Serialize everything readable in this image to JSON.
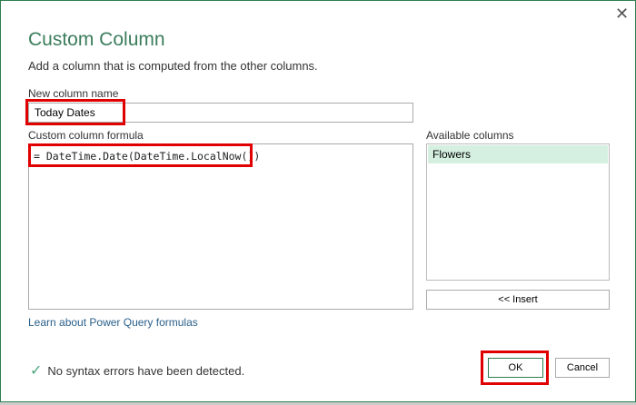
{
  "dialog": {
    "title": "Custom Column",
    "subtitle": "Add a column that is computed from the other columns.",
    "close_icon": "close-icon",
    "new_column_label": "New column name",
    "new_column_value": "Today Dates",
    "formula_label": "Custom column formula",
    "formula_value": "= DateTime.Date(DateTime.LocalNow())",
    "available_label": "Available columns",
    "available_columns": [
      "Flowers"
    ],
    "insert_label": "<< Insert",
    "learn_link": "Learn about Power Query formulas",
    "status_text": "No syntax errors have been detected.",
    "ok_label": "OK",
    "cancel_label": "Cancel"
  },
  "colors": {
    "accent": "#3b7d5c",
    "highlight": "#e00000",
    "selected_row": "#d5efe0"
  }
}
